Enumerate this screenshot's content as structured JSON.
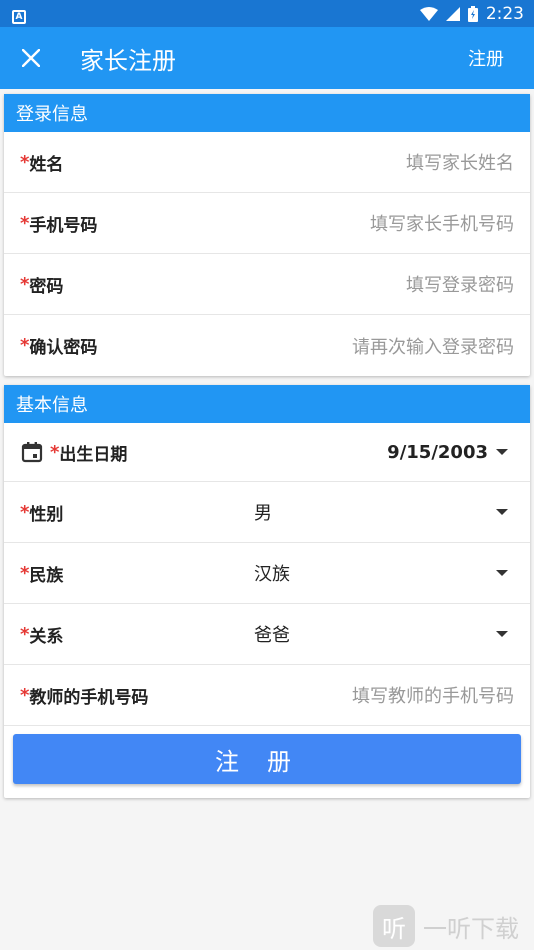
{
  "status_bar": {
    "time": "2:23",
    "notification_letter": "A"
  },
  "app_bar": {
    "title": "家长注册",
    "action": "注册"
  },
  "login_section": {
    "header": "登录信息",
    "fields": [
      {
        "required": "*",
        "label": "姓名",
        "placeholder": "填写家长姓名"
      },
      {
        "required": "*",
        "label": "手机号码",
        "placeholder": "填写家长手机号码"
      },
      {
        "required": "*",
        "label": "密码",
        "placeholder": "填写登录密码"
      },
      {
        "required": "*",
        "label": "确认密码",
        "placeholder": "请再次输入登录密码"
      }
    ]
  },
  "basic_section": {
    "header": "基本信息",
    "birth": {
      "required": "*",
      "label": "出生日期",
      "value": "9/15/2003"
    },
    "gender": {
      "required": "*",
      "label": "性别",
      "value": "男"
    },
    "ethnicity": {
      "required": "*",
      "label": "民族",
      "value": "汉族"
    },
    "relation": {
      "required": "*",
      "label": "关系",
      "value": "爸爸"
    },
    "teacher_phone": {
      "required": "*",
      "label": "教师的手机号码",
      "placeholder": "填写教师的手机号码"
    },
    "submit": "注册"
  },
  "watermark": {
    "logo_char": "听",
    "text": "一听下载"
  },
  "colors": {
    "primary": "#2196f3",
    "status_bar": "#1976d2",
    "required": "#e53935",
    "button": "#4287f5"
  },
  "icons": [
    "close-icon",
    "wifi-icon",
    "signal-icon",
    "battery-icon",
    "calendar-icon",
    "chevron-down-icon"
  ]
}
